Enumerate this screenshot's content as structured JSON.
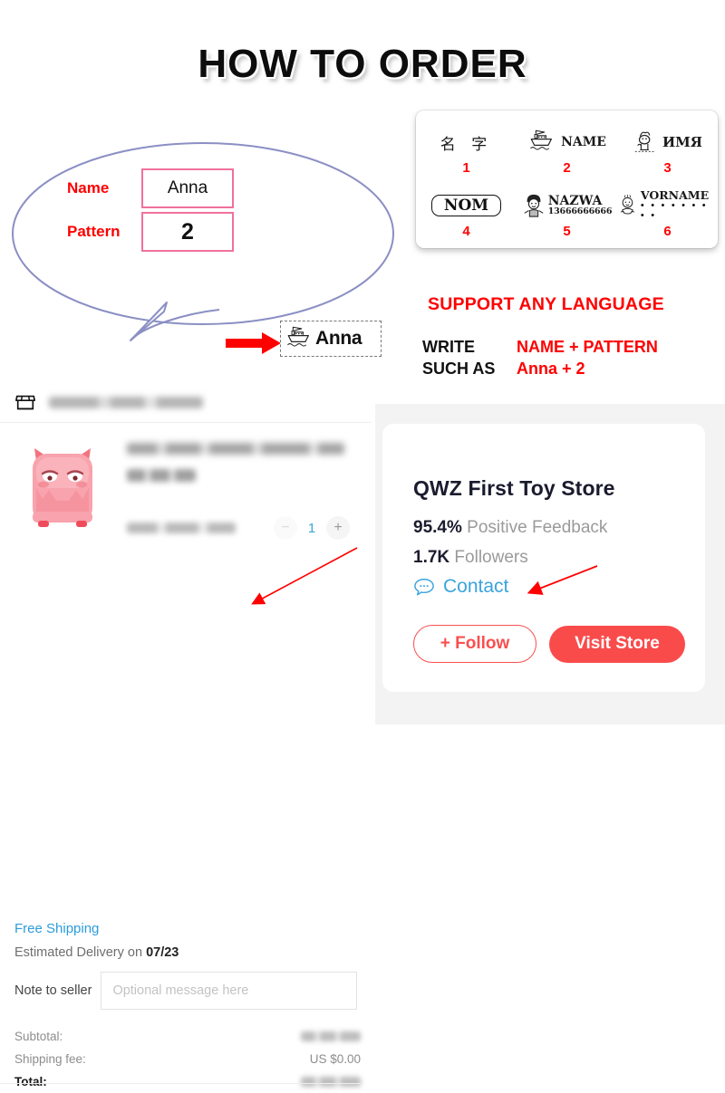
{
  "title": "HOW TO ORDER",
  "example": {
    "name_label": "Name",
    "name_value": "Anna",
    "pattern_label": "Pattern",
    "pattern_value": "2",
    "result_text": "Anna",
    "arrow_icon": "red-right-arrow",
    "boat_icon": "boat-stamp-icon"
  },
  "patterns": [
    {
      "num": "1",
      "text": "名 字",
      "sub": "",
      "icon": "none",
      "style": "cjk"
    },
    {
      "num": "2",
      "text": "NAME",
      "sub": "",
      "icon": "boat-icon",
      "style": "serif"
    },
    {
      "num": "3",
      "text": "ИМЯ",
      "sub": "",
      "icon": "animal-icon",
      "style": "serif"
    },
    {
      "num": "4",
      "text": "NOM",
      "sub": "",
      "icon": "none",
      "style": "boxed"
    },
    {
      "num": "5",
      "text": "NAZWA",
      "sub": "13666666666",
      "icon": "boy-icon",
      "style": "serif"
    },
    {
      "num": "6",
      "text": "VORNAME",
      "sub": "• • • • • • • • •",
      "icon": "baby-icon",
      "style": "serif"
    }
  ],
  "support": {
    "headline": "SUPPORT ANY LANGUAGE",
    "write_key": "WRITE",
    "write_value": "NAME + PATTERN",
    "such_as_key": "SUCH AS",
    "such_as_value": "Anna + 2"
  },
  "cart": {
    "store_icon": "storefront-icon",
    "store_name_blurred": "",
    "product_title_blurred": "",
    "product_price_blurred": "",
    "product_image": "pink-monster-stamp",
    "sku_blurred": "",
    "qty_minus": "−",
    "qty_value": "1",
    "qty_plus": "+",
    "free_shipping": "Free Shipping",
    "eta_prefix": "Estimated Delivery on ",
    "eta_date": "07/23",
    "note_label": "Note to seller",
    "note_placeholder": "Optional message here",
    "note_value": "",
    "subtotal_label": "Subtotal:",
    "subtotal_value_blurred": "",
    "shipping_label": "Shipping fee:",
    "shipping_value": "US $0.00",
    "total_label": "Total:",
    "total_value_blurred": ""
  },
  "store": {
    "name": "QWZ First Toy Store",
    "feedback_value": "95.4%",
    "feedback_label": " Positive Feedback",
    "followers_value": "1.7K",
    "followers_label": " Followers",
    "contact_label": "Contact",
    "contact_icon": "chat-bubble-icon",
    "follow_label": "+ Follow",
    "visit_label": "Visit Store"
  },
  "colors": {
    "red": "#ff0000",
    "pink_border": "#f0719d",
    "bubble": "#8b8fc4",
    "link_blue": "#2d9cdb",
    "brand_red": "#fa4b4b"
  }
}
